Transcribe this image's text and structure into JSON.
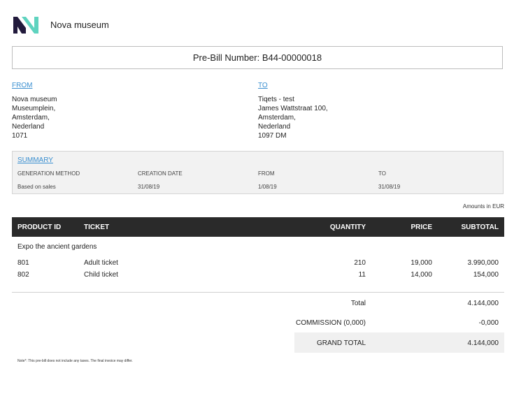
{
  "brand": {
    "name": "Nova museum",
    "logo_icon": "nn-logo-icon",
    "colors": {
      "dark": "#221a3c",
      "teal": "#5fd3bf"
    }
  },
  "bill": {
    "title": "Pre-Bill Number: B44-00000018"
  },
  "from": {
    "label": "FROM",
    "lines": [
      "Nova museum",
      "Museumplein,",
      "Amsterdam,",
      "Nederland",
      "1071"
    ]
  },
  "to": {
    "label": "TO",
    "lines": [
      "Tiqets - test",
      "James Wattstraat 100,",
      "Amsterdam,",
      "Nederland",
      "1097 DM"
    ]
  },
  "summary": {
    "label": "SUMMARY",
    "headers": [
      "GENERATION METHOD",
      "CREATION DATE",
      "FROM",
      "TO"
    ],
    "values": [
      "Based on sales",
      "31/08/19",
      "1/08/19",
      "31/08/19"
    ]
  },
  "amounts_note": "Amounts in EUR",
  "table": {
    "headers": {
      "product_id": "PRODUCT ID",
      "ticket": "TICKET",
      "quantity": "QUANTITY",
      "price": "PRICE",
      "subtotal": "SUBTOTAL"
    },
    "group": "Expo the ancient gardens",
    "rows": [
      {
        "product_id": "801",
        "ticket": "Adult ticket",
        "quantity": "210",
        "price": "19,000",
        "subtotal": "3.990,000"
      },
      {
        "product_id": "802",
        "ticket": "Child ticket",
        "quantity": "11",
        "price": "14,000",
        "subtotal": "154,000"
      }
    ]
  },
  "totals": {
    "total_label": "Total",
    "total_value": "4.144,000",
    "commission_label": "COMMISSION (0,000)",
    "commission_value": "-0,000",
    "grand_label": "GRAND TOTAL",
    "grand_value": "4.144,000"
  },
  "note": "Note*: This pre-bill does not include any taxes. The final invoice may differ."
}
